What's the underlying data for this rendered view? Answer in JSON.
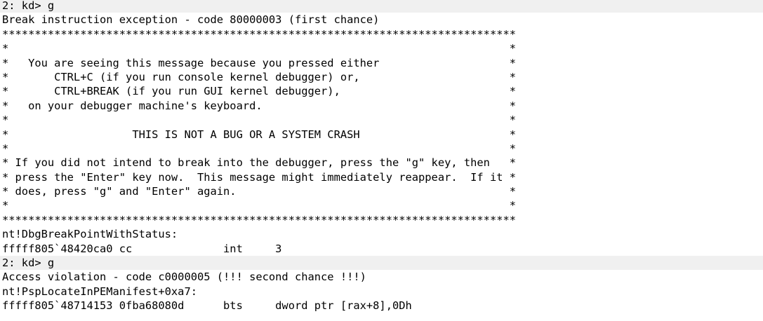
{
  "console": {
    "lines": [
      {
        "text": "2: kd> g",
        "kind": "prompt"
      },
      {
        "text": "Break instruction exception - code 80000003 (first chance)",
        "kind": "output"
      },
      {
        "text": "*******************************************************************************",
        "kind": "output"
      },
      {
        "text": "*                                                                             *",
        "kind": "output"
      },
      {
        "text": "*   You are seeing this message because you pressed either                    *",
        "kind": "output"
      },
      {
        "text": "*       CTRL+C (if you run console kernel debugger) or,                       *",
        "kind": "output"
      },
      {
        "text": "*       CTRL+BREAK (if you run GUI kernel debugger),                          *",
        "kind": "output"
      },
      {
        "text": "*   on your debugger machine's keyboard.                                      *",
        "kind": "output"
      },
      {
        "text": "*                                                                             *",
        "kind": "output"
      },
      {
        "text": "*                   THIS IS NOT A BUG OR A SYSTEM CRASH                       *",
        "kind": "output"
      },
      {
        "text": "*                                                                             *",
        "kind": "output"
      },
      {
        "text": "* If you did not intend to break into the debugger, press the \"g\" key, then   *",
        "kind": "output"
      },
      {
        "text": "* press the \"Enter\" key now.  This message might immediately reappear.  If it *",
        "kind": "output"
      },
      {
        "text": "* does, press \"g\" and \"Enter\" again.                                          *",
        "kind": "output"
      },
      {
        "text": "*                                                                             *",
        "kind": "output"
      },
      {
        "text": "*******************************************************************************",
        "kind": "output"
      },
      {
        "text": "nt!DbgBreakPointWithStatus:",
        "kind": "output"
      },
      {
        "text": "fffff805`48420ca0 cc              int     3",
        "kind": "output"
      },
      {
        "text": "2: kd> g",
        "kind": "prompt"
      },
      {
        "text": "Access violation - code c0000005 (!!! second chance !!!)",
        "kind": "output"
      },
      {
        "text": "nt!PspLocateInPEManifest+0xa7:",
        "kind": "output"
      },
      {
        "text": "fffff805`48714153 0fba68080d      bts     dword ptr [rax+8],0Dh",
        "kind": "output"
      }
    ]
  }
}
